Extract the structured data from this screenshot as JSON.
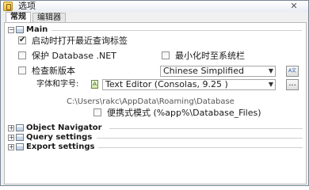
{
  "window": {
    "title": "选项",
    "close_glyph": "✕"
  },
  "tabs": [
    {
      "label": "常规",
      "active": true
    },
    {
      "label": "编辑器",
      "active": false
    }
  ],
  "sections": {
    "main": {
      "toggle": "−",
      "label": "Main"
    },
    "object_navigator": {
      "toggle": "+",
      "label": "Object Navigator"
    },
    "query_settings": {
      "toggle": "+",
      "label": "Query settings"
    },
    "export_settings": {
      "toggle": "+",
      "label": "Export settings"
    }
  },
  "main": {
    "open_last_tabs": {
      "label": "启动时打开最近查询标签",
      "checked": true
    },
    "protect_net": {
      "label": "保护 Database .NET",
      "checked": false
    },
    "minimize_tray": {
      "label": "最小化时至系统栏",
      "checked": false
    },
    "check_updates": {
      "label": "检查新版本",
      "checked": false
    },
    "language": {
      "value": "Chinese Simplified"
    },
    "lang_button": {
      "glyph": "A文"
    },
    "font": {
      "label": "字体和字号:",
      "icon_glyph": "A",
      "value": "Text Editor (Consolas, 9.25 )",
      "browse_label": "..."
    },
    "path": "C:\\Users\\rakc\\AppData\\Roaming\\Database",
    "portable": {
      "label": "便携式模式 (%app%\\Database_Files)",
      "checked": false
    }
  },
  "icons": {
    "app": "options-app-icon",
    "section": "section-panel-icon",
    "checkbox_check": "check-icon",
    "dropdown": "chevron-down-icon"
  }
}
